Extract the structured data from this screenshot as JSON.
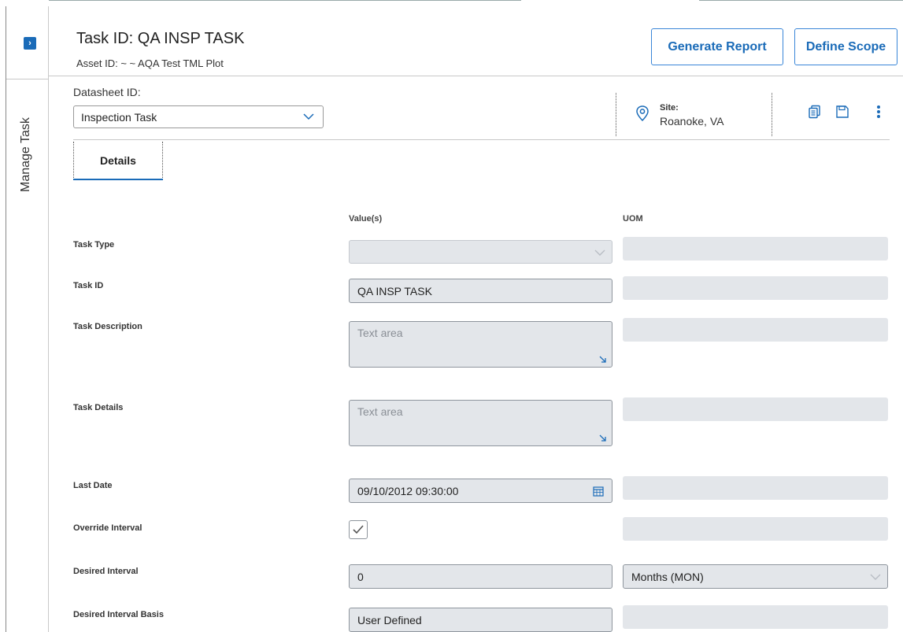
{
  "side_rail": {
    "label": "Manage Task"
  },
  "header": {
    "title": "Task ID: QA INSP TASK",
    "subtitle": "Asset ID: ~ ~ AQA Test TML Plot",
    "generate_report_label": "Generate Report",
    "define_scope_label": "Define Scope"
  },
  "datasheet": {
    "label": "Datasheet ID:",
    "selected": "Inspection Task"
  },
  "site": {
    "label": "Site:",
    "value": "Roanoke, VA"
  },
  "tabs": [
    {
      "label": "Details",
      "active": true
    }
  ],
  "columns": {
    "values": "Value(s)",
    "uom": "UOM"
  },
  "fields": {
    "task_type": {
      "label": "Task Type",
      "value": ""
    },
    "task_id": {
      "label": "Task ID",
      "value": "QA INSP TASK"
    },
    "task_description": {
      "label": "Task Description",
      "placeholder": "Text area"
    },
    "task_details": {
      "label": "Task Details",
      "placeholder": "Text area"
    },
    "last_date": {
      "label": "Last Date",
      "value": "09/10/2012 09:30:00"
    },
    "override_interval": {
      "label": "Override Interval",
      "checked": true
    },
    "desired_interval": {
      "label": "Desired Interval",
      "value": "0",
      "uom": "Months (MON)"
    },
    "desired_interval_basis": {
      "label": "Desired Interval Basis",
      "value": "User Defined"
    }
  },
  "icons": {
    "expand": "chevron-right-icon",
    "site": "location-pin-icon",
    "copy": "copy-icon",
    "save": "save-icon",
    "more": "more-vertical-icon",
    "calendar": "calendar-icon"
  },
  "colors": {
    "accent": "#1a6bb8",
    "field_bg": "#e3e6ea"
  }
}
